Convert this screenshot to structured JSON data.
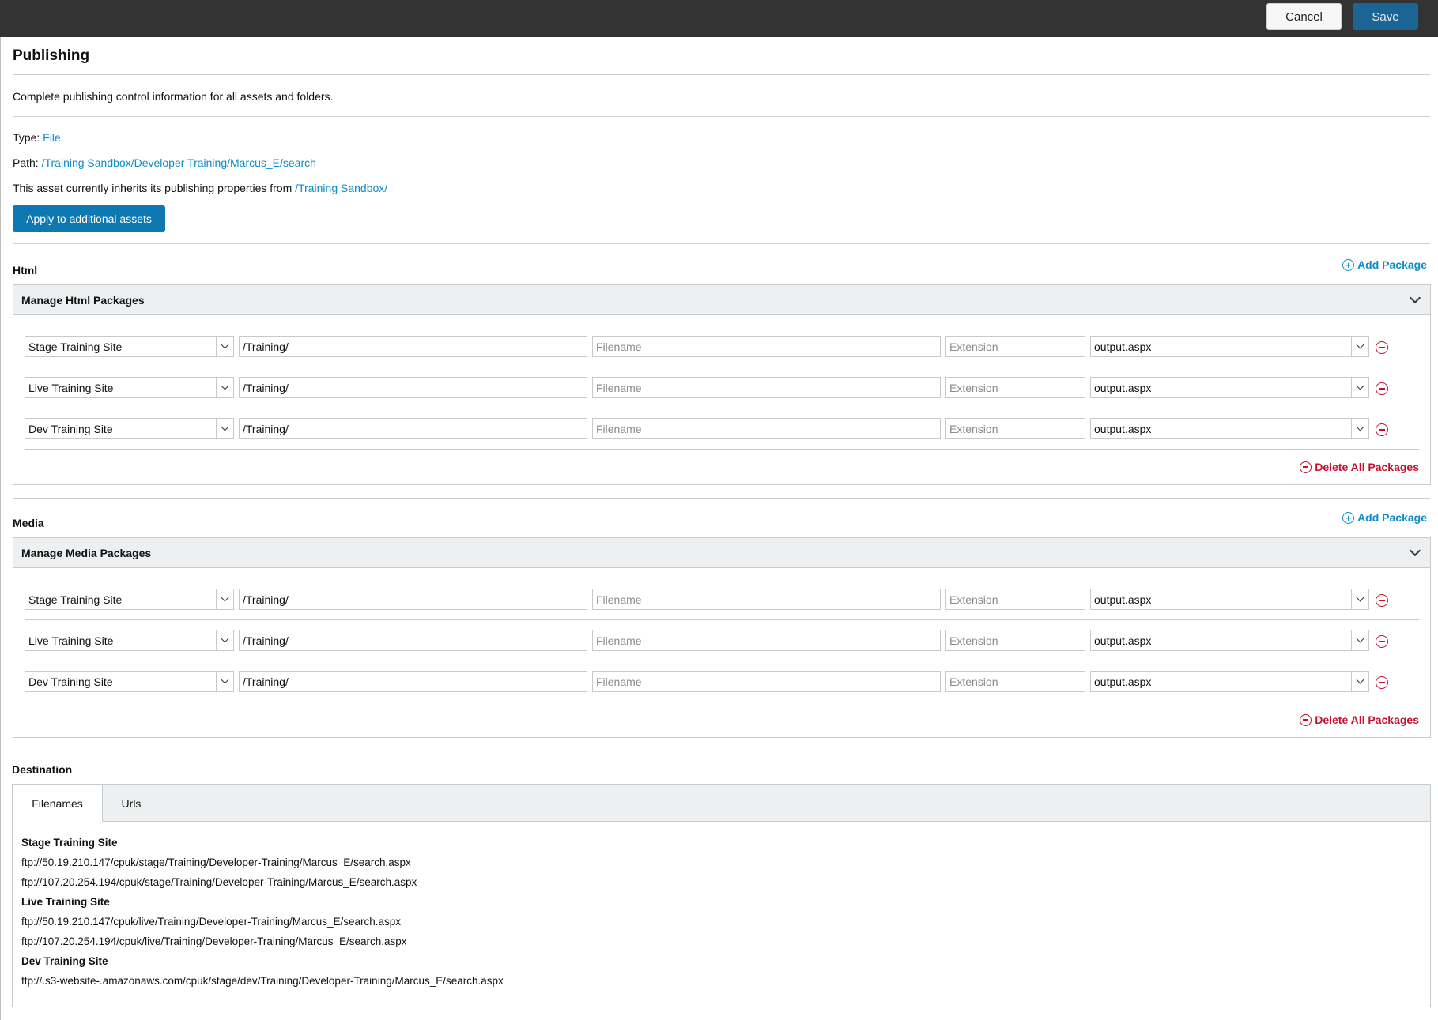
{
  "toolbar": {
    "cancel_label": "Cancel",
    "save_label": "Save"
  },
  "page": {
    "title": "Publishing",
    "description": "Complete publishing control information for all assets and folders.",
    "type_label": "Type:",
    "type_value": "File",
    "path_label": "Path:",
    "path_value": "/Training Sandbox/Developer Training/Marcus_E/search",
    "inherit_text": "This asset currently inherits its publishing properties from",
    "inherit_link": "/Training Sandbox/",
    "apply_button": "Apply to additional assets"
  },
  "html_section": {
    "label": "Html",
    "add_label": "Add Package",
    "header": "Manage Html Packages",
    "delete_all_label": "Delete All Packages",
    "rows": [
      {
        "site": "Stage Training Site",
        "path": "/Training/",
        "filename_placeholder": "Filename",
        "extension_placeholder": "Extension",
        "template": "output.aspx"
      },
      {
        "site": "Live Training Site",
        "path": "/Training/",
        "filename_placeholder": "Filename",
        "extension_placeholder": "Extension",
        "template": "output.aspx"
      },
      {
        "site": "Dev Training Site",
        "path": "/Training/",
        "filename_placeholder": "Filename",
        "extension_placeholder": "Extension",
        "template": "output.aspx"
      }
    ]
  },
  "media_section": {
    "label": "Media",
    "add_label": "Add Package",
    "header": "Manage Media Packages",
    "delete_all_label": "Delete All Packages",
    "rows": [
      {
        "site": "Stage Training Site",
        "path": "/Training/",
        "filename_placeholder": "Filename",
        "extension_placeholder": "Extension",
        "template": "output.aspx"
      },
      {
        "site": "Live Training Site",
        "path": "/Training/",
        "filename_placeholder": "Filename",
        "extension_placeholder": "Extension",
        "template": "output.aspx"
      },
      {
        "site": "Dev Training Site",
        "path": "/Training/",
        "filename_placeholder": "Filename",
        "extension_placeholder": "Extension",
        "template": "output.aspx"
      }
    ]
  },
  "destination": {
    "label": "Destination",
    "tabs": [
      "Filenames",
      "Urls"
    ],
    "active_tab": "Filenames",
    "sites": [
      {
        "name": "Stage Training Site",
        "urls": [
          "ftp://50.19.210.147/cpuk/stage/Training/Developer-Training/Marcus_E/search.aspx",
          "ftp://107.20.254.194/cpuk/stage/Training/Developer-Training/Marcus_E/search.aspx"
        ]
      },
      {
        "name": "Live Training Site",
        "urls": [
          "ftp://50.19.210.147/cpuk/live/Training/Developer-Training/Marcus_E/search.aspx",
          "ftp://107.20.254.194/cpuk/live/Training/Developer-Training/Marcus_E/search.aspx"
        ]
      },
      {
        "name": "Dev Training Site",
        "urls": [
          "ftp://.s3-website-.amazonaws.com/cpuk/stage/dev/Training/Developer-Training/Marcus_E/search.aspx"
        ]
      }
    ]
  },
  "colors": {
    "link": "#0f8cc9",
    "primary_button": "#0e78b3",
    "save_button": "#1a6496",
    "danger": "#c8102e",
    "topbar": "#333333"
  },
  "icons": [
    "plus-circle-icon",
    "minus-circle-icon",
    "chevron-down-icon"
  ]
}
